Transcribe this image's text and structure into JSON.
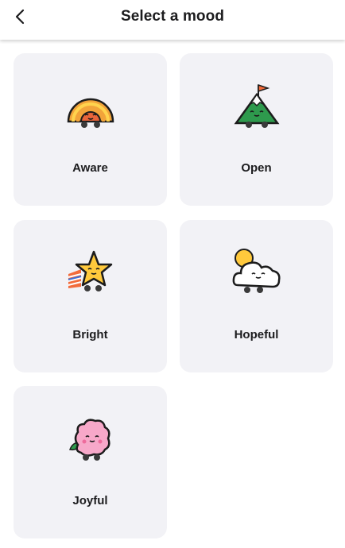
{
  "header": {
    "title": "Select a mood",
    "back_icon": "chevron-left-icon"
  },
  "moods": [
    {
      "label": "Aware",
      "icon": "rainbow-icon"
    },
    {
      "label": "Open",
      "icon": "mountain-icon"
    },
    {
      "label": "Bright",
      "icon": "star-icon"
    },
    {
      "label": "Hopeful",
      "icon": "sun-cloud-icon"
    },
    {
      "label": "Joyful",
      "icon": "flower-icon"
    }
  ],
  "colors": {
    "card_bg": "#f2f2f6",
    "title_text": "#1c1c1e"
  }
}
